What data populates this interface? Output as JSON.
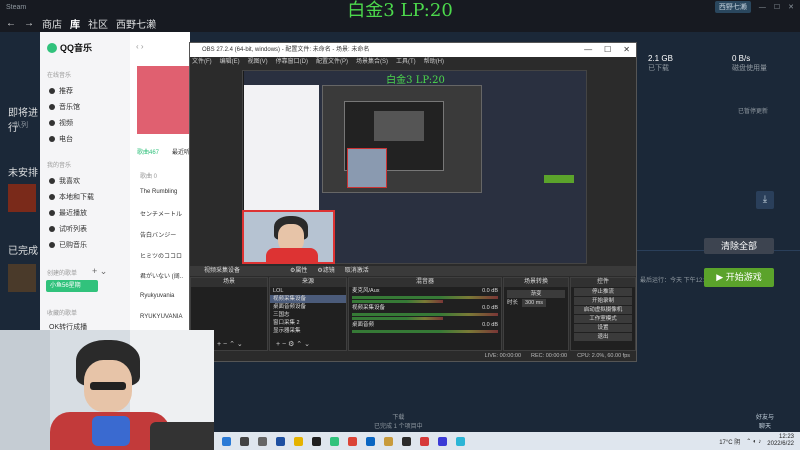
{
  "overlay_title": "白金3 LP:20",
  "steam": {
    "top_app": "Steam",
    "nav": {
      "store": "商店",
      "library": "库",
      "community": "社区",
      "user": "西野七濑"
    },
    "user_badge": "西野七濑",
    "stats": [
      {
        "value": "2.1 GB",
        "label": "已下载"
      },
      {
        "value": "0 B/s",
        "label": "磁盘使用量"
      }
    ],
    "queue_heading": "即将进行",
    "queue_sub": "队列",
    "unscheduled": "未安排",
    "completed": "已完成",
    "clear_all": "清除全部",
    "play": "▶ 开始游戏",
    "right_note": "已暂停更新",
    "last_played": "最后运行：今天 下午12:23",
    "friends": "好友与\n聊天",
    "download_footer": "下载\n已完成 1 个项目中"
  },
  "qq": {
    "app": "QQ音乐",
    "sections": {
      "online": "在线音乐",
      "mine": "我的音乐",
      "created": "创建的歌单",
      "collected": "收藏的歌单"
    },
    "online_items": [
      "推荐",
      "音乐馆",
      "视频",
      "电台"
    ],
    "my_items": [
      "我喜欢",
      "本地和下载",
      "最近播放",
      "试听列表",
      "已购音乐"
    ],
    "active_playlist": "小鱼56星期",
    "collected_item": "OK转行成播",
    "tab_song": "歌曲467",
    "tab_other": "最近听",
    "rows": [
      "歌曲 0",
      "The Rumbling",
      "センチメートル",
      "告白バンジー",
      "ヒミツのココロ",
      "君がいない (阔..",
      "Ryukyuvania",
      "RYUKYUVANIA"
    ]
  },
  "obs": {
    "title": "OBS 27.2.4 (64-bit, windows) - 配置文件: 未命名 - 场景: 未命名",
    "menu": [
      "文件(F)",
      "编辑(E)",
      "视图(V)",
      "停靠窗口(D)",
      "配置文件(P)",
      "场景集合(S)",
      "工具(T)",
      "帮助(H)"
    ],
    "preview_title": "白金3 LP:20",
    "source_bar": {
      "device": "视频采集设备",
      "props": "⚙属性",
      "filter": "⚙滤镜",
      "deactivate": "取消激活"
    },
    "docks": {
      "scenes": {
        "header": "场景",
        "items": []
      },
      "sources": {
        "header": "来源",
        "items": [
          "LOL",
          "视频采集设备",
          "桌面音频设备",
          "三国志",
          "窗口采集 2",
          "显示器采集"
        ]
      },
      "mixer": {
        "header": "混音器",
        "items": [
          {
            "name": "麦克风/Aux",
            "level": "0.0 dB"
          },
          {
            "name": "视频采集设备",
            "level": "0.0 dB"
          },
          {
            "name": "桌面音频",
            "level": "0.0 dB"
          }
        ]
      },
      "transitions": {
        "header": "场景转换",
        "type": "渐变",
        "duration_label": "时长",
        "duration": "300 ms"
      },
      "controls": {
        "header": "控件",
        "buttons": [
          "停止推流",
          "开始录制",
          "启动虚拟摄像机",
          "工作室模式",
          "设置",
          "退出"
        ]
      }
    },
    "status": {
      "live": "LIVE: 00:00:00",
      "rec": "REC: 00:00:00",
      "cpu": "CPU: 2.0%, 60.00 fps"
    }
  },
  "taskbar": {
    "weather": "17°C 阴",
    "time": "12:23",
    "date": "2022/6/22"
  },
  "colors": {
    "accent_green": "#4cd94c",
    "steam_play": "#5ba32b",
    "qq_green": "#31c27c",
    "obs_cam_border": "#dd3333"
  }
}
